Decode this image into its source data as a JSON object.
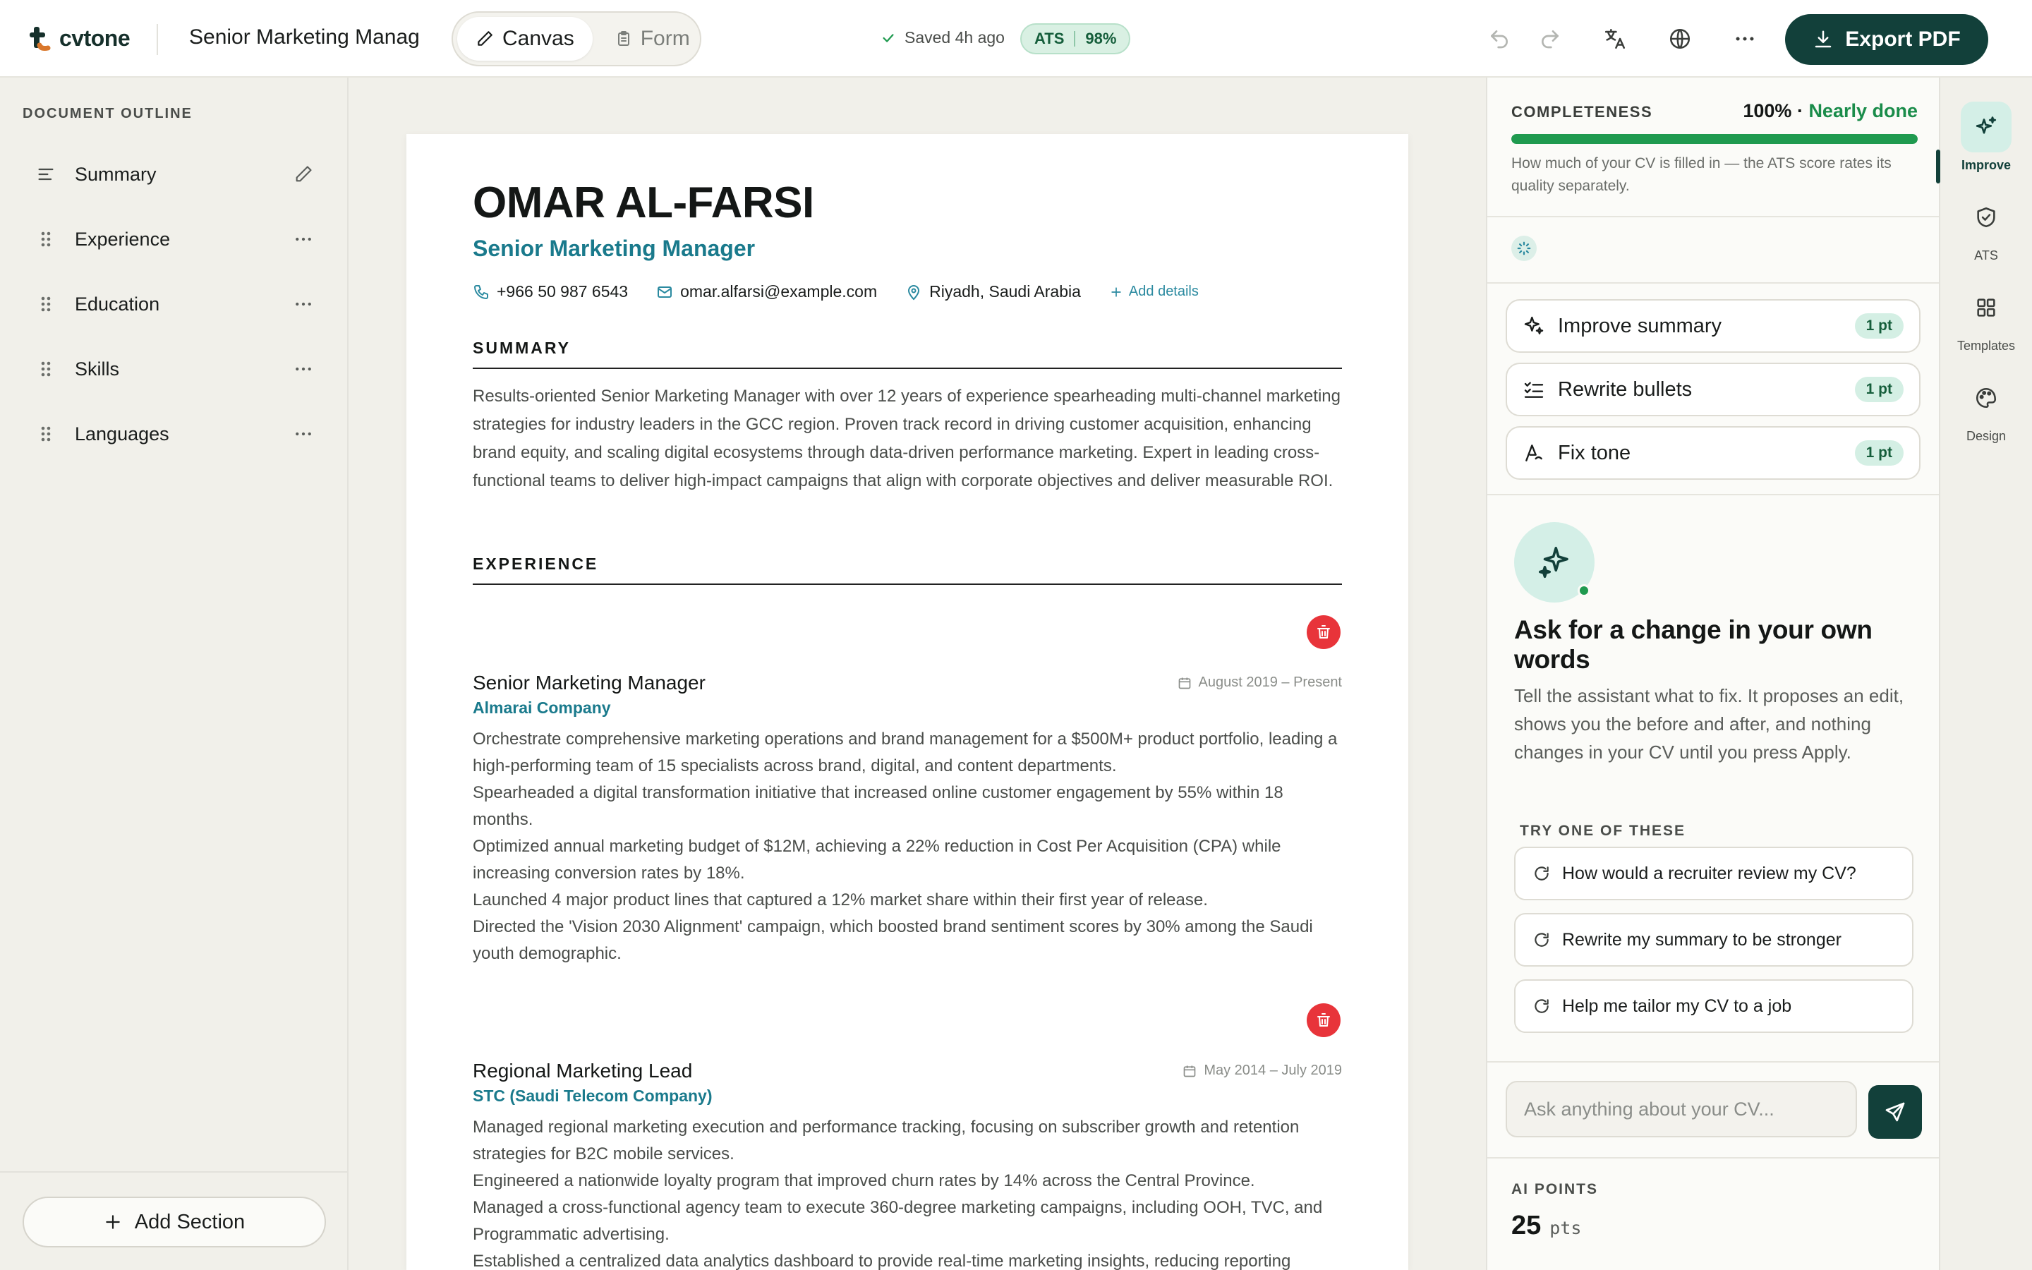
{
  "app": {
    "name": "cvtone",
    "document_title": "Senior Marketing Manag"
  },
  "toolbar": {
    "modes": [
      {
        "label": "Canvas",
        "active": true
      },
      {
        "label": "Form",
        "active": false
      }
    ],
    "saved_status": "Saved 4h ago",
    "ats_label": "ATS",
    "ats_score": "98%",
    "export_label": "Export PDF"
  },
  "outline": {
    "heading": "DOCUMENT OUTLINE",
    "items": [
      {
        "label": "Summary"
      },
      {
        "label": "Experience"
      },
      {
        "label": "Education"
      },
      {
        "label": "Skills"
      },
      {
        "label": "Languages"
      }
    ],
    "add_section": "Add Section"
  },
  "cv": {
    "name": "OMAR AL-FARSI",
    "role": "Senior Marketing Manager",
    "phone": "+966 50 987 6543",
    "email": "omar.alfarsi@example.com",
    "location": "Riyadh, Saudi Arabia",
    "add_details": "Add details",
    "summary_heading": "SUMMARY",
    "summary": "Results-oriented Senior Marketing Manager with over 12 years of experience spearheading multi-channel marketing strategies for industry leaders in the GCC region. Proven track record in driving customer acquisition, enhancing brand equity, and scaling digital ecosystems through data-driven performance marketing. Expert in leading cross-functional teams to deliver high-impact campaigns that align with corporate objectives and deliver measurable ROI.",
    "experience_heading": "EXPERIENCE",
    "jobs": [
      {
        "title": "Senior Marketing Manager",
        "company": "Almarai Company",
        "dates": "August 2019 – Present",
        "bullets": [
          "Orchestrate comprehensive marketing operations and brand management for a $500M+ product portfolio, leading a high-performing team of 15 specialists across brand, digital, and content departments.",
          "Spearheaded a digital transformation initiative that increased online customer engagement by 55% within 18 months.",
          "Optimized annual marketing budget of $12M, achieving a 22% reduction in Cost Per Acquisition (CPA) while increasing conversion rates by 18%.",
          "Launched 4 major product lines that captured a 12% market share within their first year of release.",
          "Directed the 'Vision 2030 Alignment' campaign, which boosted brand sentiment scores by 30% among the Saudi youth demographic."
        ]
      },
      {
        "title": "Regional Marketing Lead",
        "company": "STC (Saudi Telecom Company)",
        "dates": "May 2014 – July 2019",
        "bullets": [
          "Managed regional marketing execution and performance tracking, focusing on subscriber growth and retention strategies for B2C mobile services.",
          "Engineered a nationwide loyalty program that improved churn rates by 14% across the Central Province.",
          "Managed a cross-functional agency team to execute 360-degree marketing campaigns, including OOH, TVC, and Programmatic advertising.",
          "Established a centralized data analytics dashboard to provide real-time marketing insights, reducing reporting"
        ]
      }
    ]
  },
  "panel": {
    "completeness_label": "COMPLETENESS",
    "completeness_value": "100%",
    "completeness_percent": 100,
    "completeness_note": "Nearly done",
    "completeness_desc": "How much of your CV is filled in — the ATS score rates its quality separately.",
    "quick_actions": [
      {
        "label": "Improve summary",
        "points": "1 pt"
      },
      {
        "label": "Rewrite bullets",
        "points": "1 pt"
      },
      {
        "label": "Fix tone",
        "points": "1 pt"
      }
    ],
    "ask_title": "Ask for a change in your own words",
    "ask_desc": "Tell the assistant what to fix. It proposes an edit, shows you the before and after, and nothing changes in your CV until you press Apply.",
    "try_heading": "TRY ONE OF THESE",
    "suggestions": [
      "How would a recruiter review my CV?",
      "Rewrite my summary to be stronger",
      "Help me tailor my CV to a job"
    ],
    "input_placeholder": "Ask anything about your CV...",
    "points_label": "AI POINTS",
    "points_value": "25",
    "points_unit": "pts"
  },
  "rail": {
    "items": [
      {
        "label": "Improve",
        "icon": "sparkles-icon",
        "active": true
      },
      {
        "label": "ATS",
        "icon": "shield-check-icon",
        "active": false
      },
      {
        "label": "Templates",
        "icon": "grid-icon",
        "active": false
      },
      {
        "label": "Design",
        "icon": "palette-icon",
        "active": false
      }
    ]
  },
  "colors": {
    "brand": "#12403a",
    "accent_teal": "#1a7a8c",
    "success": "#1f9a4f",
    "danger": "#e8343a"
  }
}
